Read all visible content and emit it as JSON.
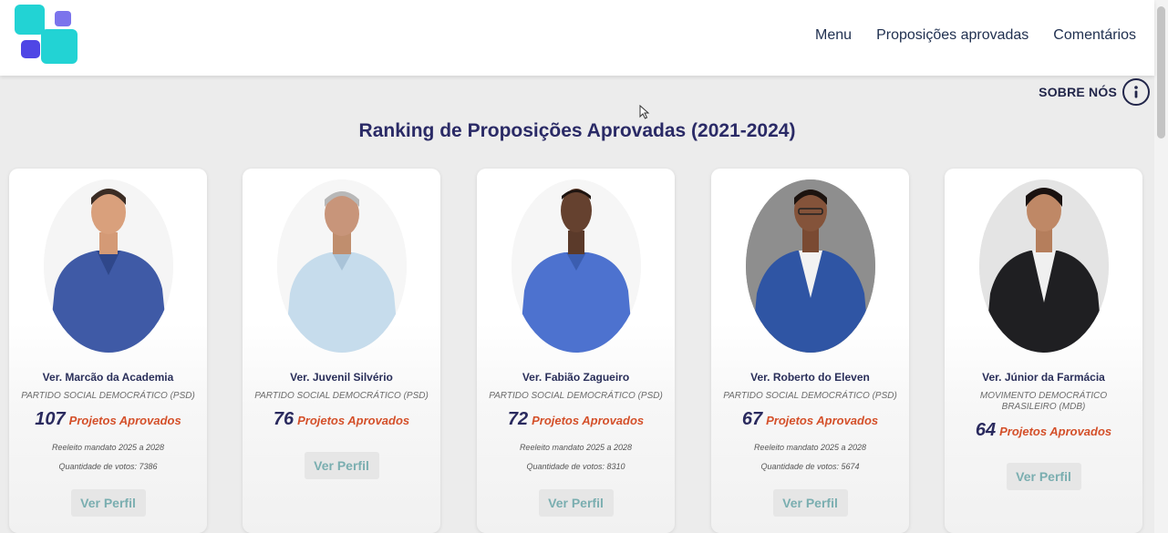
{
  "header": {
    "logo": "app-logo",
    "nav": [
      "Menu",
      "Proposições aprovadas",
      "Comentários"
    ]
  },
  "about": {
    "label": "SOBRE NÓS",
    "icon": "info-icon"
  },
  "page_title": "Ranking de Proposições Aprovadas (2021-2024)",
  "colors": {
    "title": "#2a2a66",
    "count_label": "#d4502a",
    "button_text": "#7aaeb0",
    "logo_teal": "#22d3d4",
    "logo_purple": "#7b74ec"
  },
  "cards": [
    {
      "name": "Ver. Marcão da Academia",
      "party": "PARTIDO SOCIAL DEMOCRÁTICO (PSD)",
      "count": "107",
      "count_label": "Projetos Aprovados",
      "mandate": "Reeleito mandato 2025 a 2028",
      "votes": "Quantidade de votos: 7386",
      "button": "Ver Perfil"
    },
    {
      "name": "Ver. Juvenil Silvério",
      "party": "PARTIDO SOCIAL DEMOCRÁTICO (PSD)",
      "count": "76",
      "count_label": "Projetos Aprovados",
      "button": "Ver Perfil"
    },
    {
      "name": "Ver. Fabião Zagueiro",
      "party": "PARTIDO SOCIAL DEMOCRÁTICO (PSD)",
      "count": "72",
      "count_label": "Projetos Aprovados",
      "mandate": "Reeleito mandato 2025 a 2028",
      "votes": "Quantidade de votos: 8310",
      "button": "Ver Perfil"
    },
    {
      "name": "Ver. Roberto do Eleven",
      "party": "PARTIDO SOCIAL DEMOCRÁTICO (PSD)",
      "count": "67",
      "count_label": "Projetos Aprovados",
      "mandate": "Reeleito mandato 2025 a 2028",
      "votes": "Quantidade de votos: 5674",
      "button": "Ver Perfil"
    },
    {
      "name": "Ver. Júnior da Farmácia",
      "party": "MOVIMENTO DEMOCRÁTICO BRASILEIRO (MDB)",
      "count": "64",
      "count_label": "Projetos Aprovados",
      "button": "Ver Perfil"
    }
  ]
}
